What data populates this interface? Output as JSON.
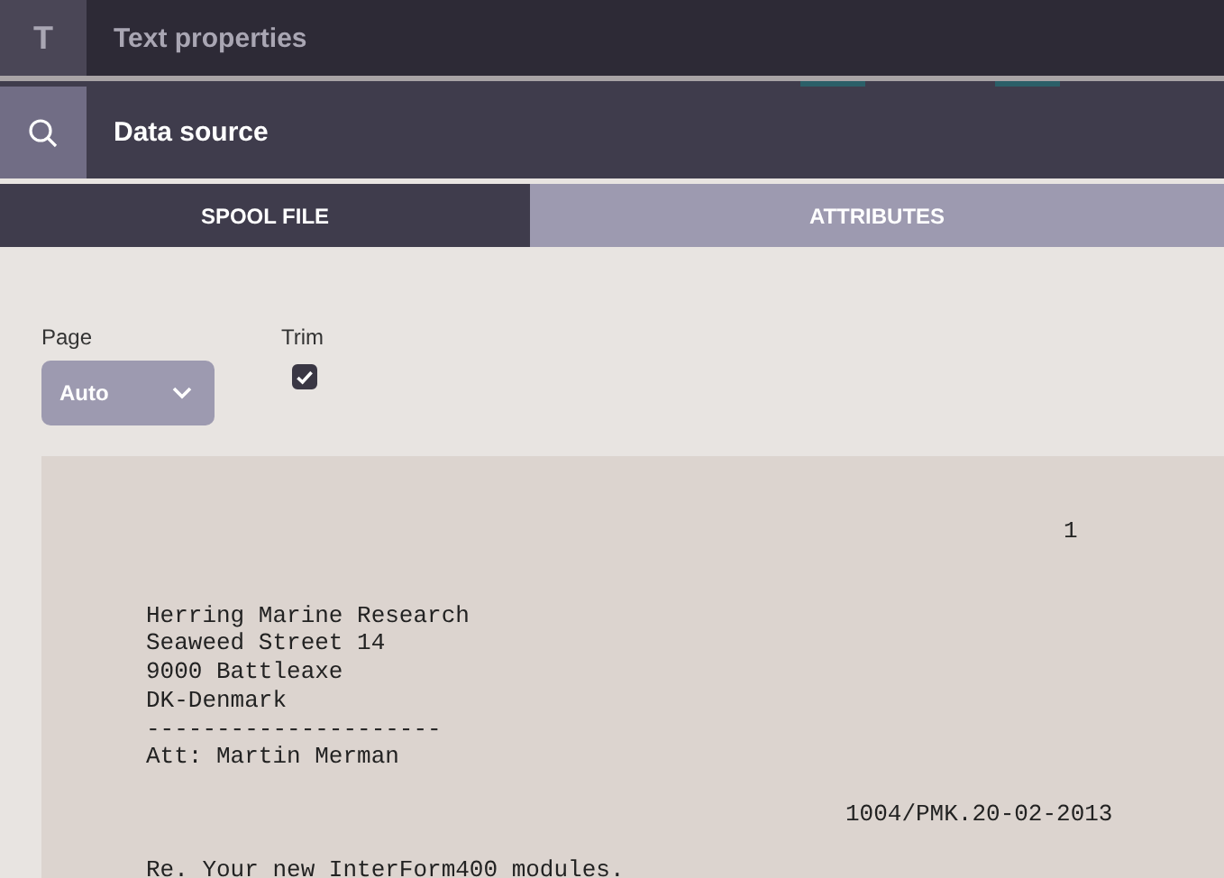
{
  "header": {
    "icon": "T",
    "title": "Text properties"
  },
  "section": {
    "title": "Data source"
  },
  "tabs": [
    {
      "label": "SPOOL FILE",
      "selected": true
    },
    {
      "label": "ATTRIBUTES",
      "selected": false
    }
  ],
  "page": {
    "label": "Page",
    "value": "Auto"
  },
  "trim": {
    "label": "Trim",
    "checked": true
  },
  "spool": {
    "page_number": "1",
    "address": [
      "Herring Marine Research",
      "Seaweed Street 14",
      "9000 Battleaxe",
      "DK-Denmark",
      "---------------------",
      "Att: Martin Merman"
    ],
    "reference": "1004/PMK.20-02-2013",
    "body": [
      "Re. Your new InterForm400 modules."
    ]
  }
}
